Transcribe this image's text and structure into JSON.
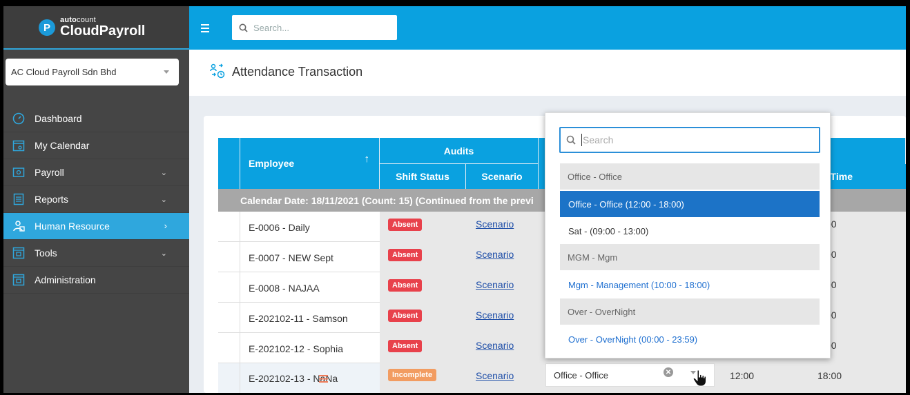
{
  "app": {
    "logo_small_bold": "auto",
    "logo_small_light": "count",
    "logo_big": "CloudPayroll",
    "logo_letter": "P"
  },
  "company_selector": {
    "value": "AC Cloud Payroll Sdn Bhd"
  },
  "sidebar": {
    "items": [
      {
        "label": "Dashboard",
        "icon": "dashboard-icon",
        "chevron": ""
      },
      {
        "label": "My Calendar",
        "icon": "calendar-icon",
        "chevron": ""
      },
      {
        "label": "Payroll",
        "icon": "payroll-icon",
        "chevron": "⌄"
      },
      {
        "label": "Reports",
        "icon": "reports-icon",
        "chevron": "⌄"
      },
      {
        "label": "Human Resource",
        "icon": "human-resource-icon",
        "chevron": "›",
        "active": true
      },
      {
        "label": "Tools",
        "icon": "tools-icon",
        "chevron": "⌄"
      },
      {
        "label": "Administration",
        "icon": "administration-icon",
        "chevron": ""
      }
    ]
  },
  "topbar": {
    "search_placeholder": "Search..."
  },
  "page": {
    "title": "Attendance Transaction"
  },
  "table": {
    "headers": {
      "employee": "Employee",
      "sort_arrow": "↑",
      "audits": "Audits",
      "shift_status": "Shift Status",
      "scenario": "Scenario",
      "time_partial": "t Time"
    },
    "group_row": "Calendar Date: 18/11/2021 (Count: 15) (Continued from the previ",
    "rows": [
      {
        "employee": "E-0006 - Daily",
        "status": "Absent",
        "scenario": "Scenario",
        "time": "00"
      },
      {
        "employee": "E-0007 - NEW Sept",
        "status": "Absent",
        "scenario": "Scenario",
        "time": "00"
      },
      {
        "employee": "E-0008 - NAJAA",
        "status": "Absent",
        "scenario": "Scenario",
        "time": "00"
      },
      {
        "employee": "E-202102-11 - Samson",
        "status": "Absent",
        "scenario": "Scenario",
        "time": "00"
      },
      {
        "employee": "E-202102-12 - Sophia",
        "status": "Absent",
        "scenario": "Scenario",
        "time": "00"
      },
      {
        "employee": "E-202102-13 - NaNa",
        "status": "Incomplete",
        "scenario": "Scenario",
        "shift": "Office - Office",
        "time_in": "12:00",
        "time_out": "18:00"
      }
    ]
  },
  "dropdown": {
    "search_placeholder": "Search",
    "options": [
      {
        "label": "Office - Office",
        "kind": "group"
      },
      {
        "label": "Office - Office (12:00 - 18:00)",
        "kind": "selected"
      },
      {
        "label": "Sat - (09:00 - 13:00)",
        "kind": "plain"
      },
      {
        "label": "MGM - Mgm",
        "kind": "group"
      },
      {
        "label": "Mgm - Management (10:00 - 18:00)",
        "kind": "blue"
      },
      {
        "label": "Over - OverNight",
        "kind": "group"
      },
      {
        "label": "Over - OverNight (00:00 - 23:59)",
        "kind": "blue"
      }
    ]
  },
  "colors": {
    "primary": "#0aa1e0",
    "sidebar": "#454545",
    "absent": "#e8414b",
    "incomplete": "#f29c61",
    "selected_option": "#1c73c7"
  }
}
